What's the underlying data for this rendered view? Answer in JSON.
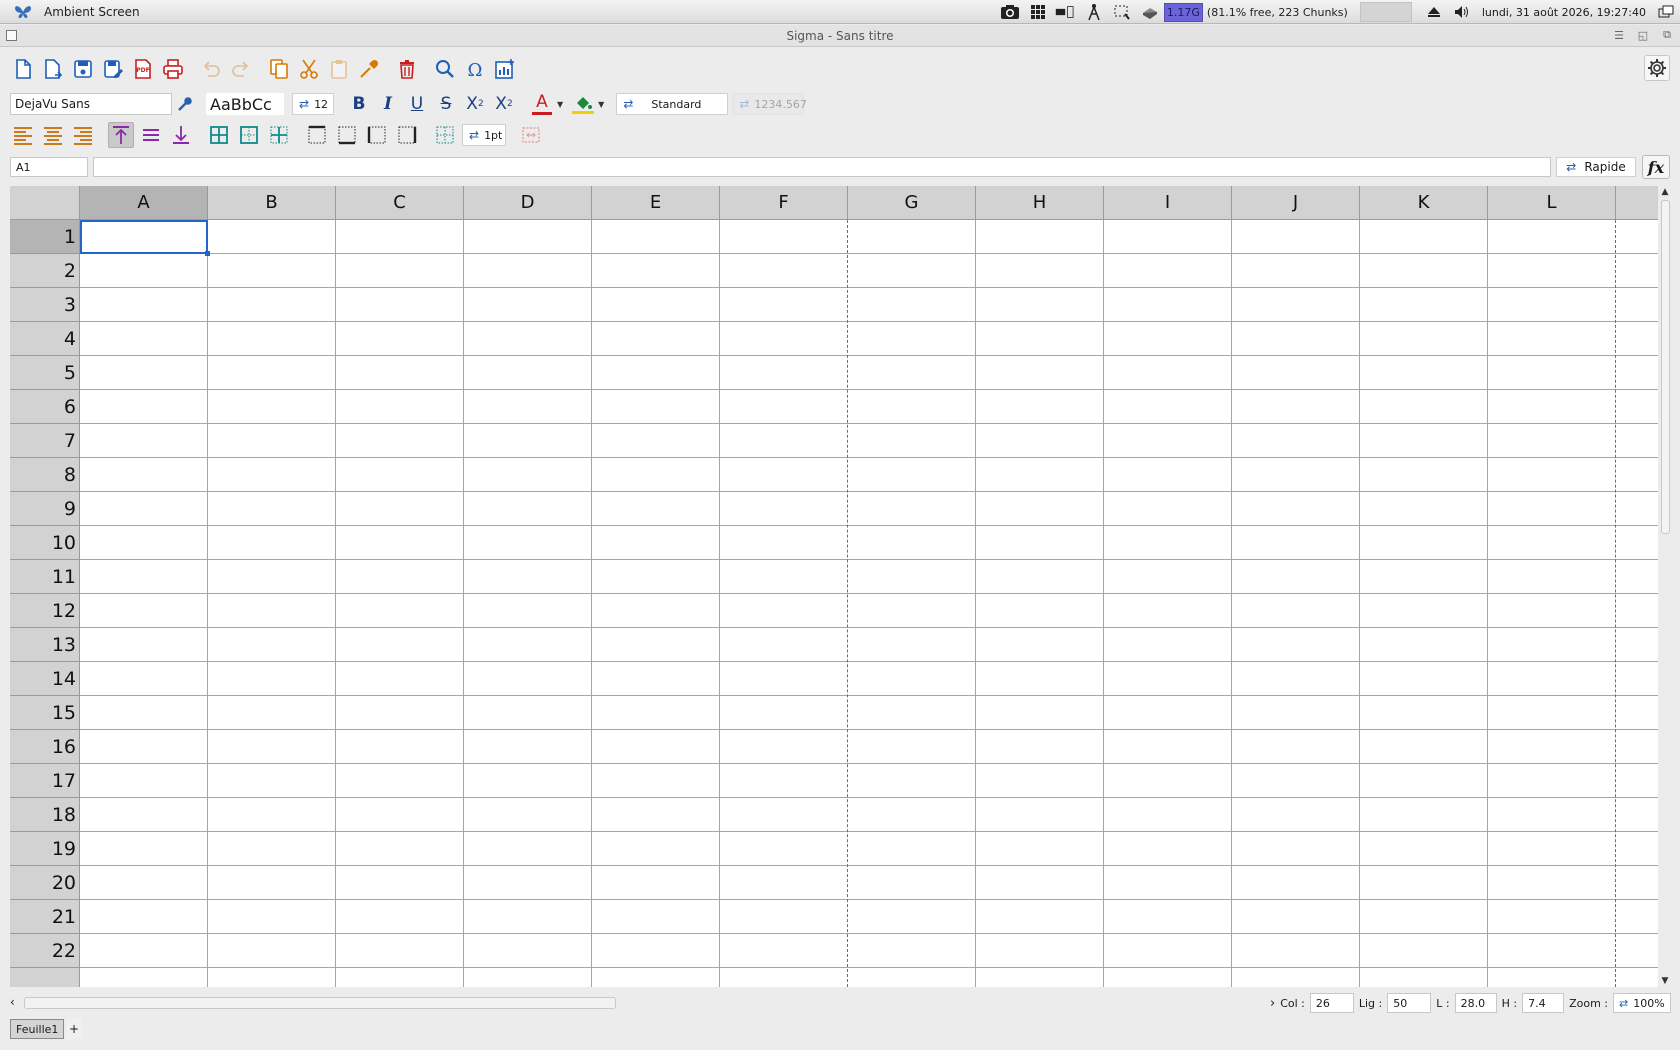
{
  "panel": {
    "app_name": "Ambient Screen",
    "memory_used": "1.17G",
    "memory_free": "(81.1% free, 223 Chunks)",
    "clock": "lundi, 31 août 2026, 19:27:40"
  },
  "window": {
    "title": "Sigma - Sans titre"
  },
  "toolbar": {
    "font_name": "DejaVu Sans",
    "font_preview": "AaBbCc",
    "font_size": "12",
    "number_format": "Standard",
    "number_sample": "1234.567",
    "border_width": "1pt"
  },
  "formula_bar": {
    "cell_ref": "A1",
    "formula": "",
    "mode": "Rapide"
  },
  "grid": {
    "columns": [
      "A",
      "B",
      "C",
      "D",
      "E",
      "F",
      "G",
      "H",
      "I",
      "J",
      "K",
      "L"
    ],
    "rows": [
      "1",
      "2",
      "3",
      "4",
      "5",
      "6",
      "7",
      "8",
      "9",
      "10",
      "11",
      "12",
      "13",
      "14",
      "15",
      "16",
      "17",
      "18",
      "19",
      "20",
      "21",
      "22"
    ],
    "selected_cell": "A1"
  },
  "status": {
    "col_label": "Col :",
    "col_value": "26",
    "lig_label": "Lig :",
    "lig_value": "50",
    "l_label": "L :",
    "l_value": "28.0",
    "h_label": "H :",
    "h_value": "7.4",
    "zoom_label": "Zoom :",
    "zoom_value": "100%"
  },
  "sheets": {
    "tabs": [
      "Feuille1"
    ],
    "add_label": "+"
  },
  "colors": {
    "accent": "#2465c8",
    "header_bg": "#d2d2d2",
    "selected_header_bg": "#b4b4b4",
    "page_break": "#3a72d8"
  }
}
